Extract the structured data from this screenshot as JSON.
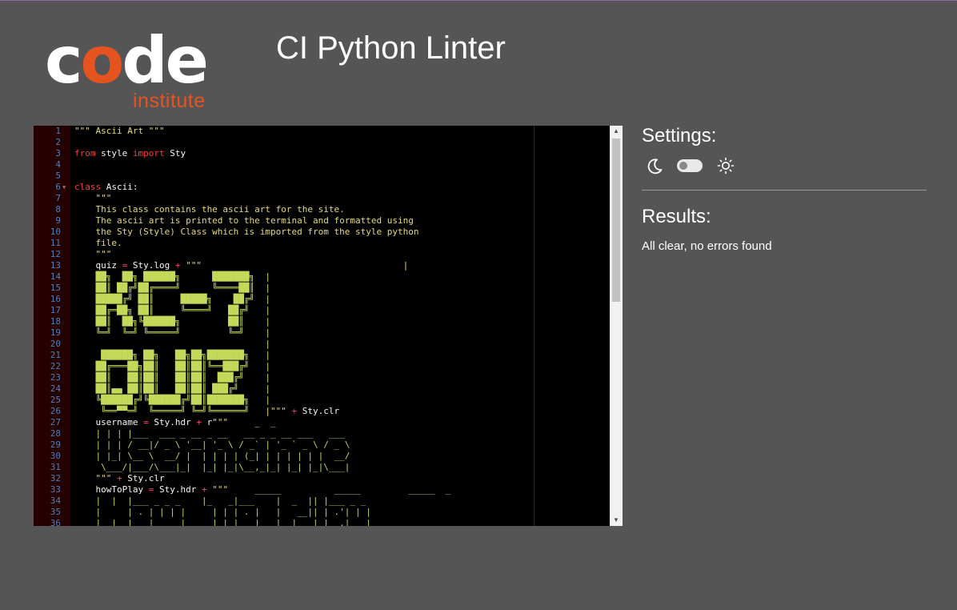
{
  "logo": {
    "word_c": "c",
    "word_o": "o",
    "word_de": "de",
    "sub": "institute"
  },
  "header": {
    "title": "CI Python Linter"
  },
  "sidebar": {
    "settings_heading": "Settings:",
    "results_heading": "Results:",
    "results_text": "All clear, no errors found",
    "toggle_state": "off"
  },
  "editor": {
    "lines": [
      [
        [
          "str",
          "\"\"\" Ascii Art \"\"\""
        ]
      ],
      [],
      [
        [
          "kw",
          "from"
        ],
        [
          "id",
          " style "
        ],
        [
          "kw",
          "import"
        ],
        [
          "id",
          " Sty"
        ]
      ],
      [],
      [],
      [
        [
          "kw",
          "class"
        ],
        [
          "id",
          " Ascii:"
        ]
      ],
      [
        [
          "str",
          "    \"\"\""
        ]
      ],
      [
        [
          "str",
          "    This class contains the ascii art for the site."
        ]
      ],
      [
        [
          "str",
          "    The ascii art is printed to the terminal and formatted using"
        ]
      ],
      [
        [
          "str",
          "    the Sty (Style) Class which is imported from the style python"
        ]
      ],
      [
        [
          "str",
          "    file."
        ]
      ],
      [
        [
          "str",
          "    \"\"\""
        ]
      ],
      [
        [
          "id",
          "    quiz "
        ],
        [
          "op",
          "="
        ],
        [
          "id",
          " Sty.log "
        ],
        [
          "op",
          "+"
        ],
        [
          "str",
          " \"\"\"                                      |"
        ]
      ],
      [
        [
          "art",
          "    ██╗  ██╗ ██████╗      ███████╗  |"
        ]
      ],
      [
        [
          "art",
          "    ██║ ██╔╝██╔════╝      ╚════██║  |"
        ]
      ],
      [
        [
          "art",
          "    █████╔╝ ██║     █████╗    ██╔╝  |"
        ]
      ],
      [
        [
          "art",
          "    ██╔═██╗ ██║     ╚════╝   ██╔╝   |"
        ]
      ],
      [
        [
          "art",
          "    ██║  ██╗╚██████╗         ██║    |"
        ]
      ],
      [
        [
          "art",
          "    ╚═╝  ╚═╝ ╚═════╝         ╚═╝    |"
        ]
      ],
      [
        [
          "art",
          "                                    |"
        ]
      ],
      [
        [
          "art",
          "     ██████╗ ██╗   ██╗██╗███████╗   |"
        ]
      ],
      [
        [
          "art",
          "    ██╔═══██╗██║   ██║██║╚══███╔╝   |"
        ]
      ],
      [
        [
          "art",
          "    ██║   ██║██║   ██║██║  ███╔╝    |"
        ]
      ],
      [
        [
          "art",
          "    ██║▄▄ ██║██║   ██║██║ ███╔╝     |"
        ]
      ],
      [
        [
          "art",
          "    ╚██████╔╝╚██████╔╝██║███████╗   |"
        ]
      ],
      [
        [
          "art",
          "     ╚══▀▀═╝  ╚═════╝ ╚═╝╚══════╝   "
        ],
        [
          "str",
          "|\"\"\""
        ],
        [
          "op",
          " +"
        ],
        [
          "id",
          " Sty.clr"
        ]
      ],
      [
        [
          "id",
          "    username "
        ],
        [
          "op",
          "="
        ],
        [
          "id",
          " Sty.hdr "
        ],
        [
          "op",
          "+"
        ],
        [
          "id",
          " r"
        ],
        [
          "str",
          "\"\"\"     _  _"
        ]
      ],
      [
        [
          "art",
          "    | | | |___  ___ _ __ _ __   __ _ _ __ ___   ___"
        ]
      ],
      [
        [
          "art",
          "    | | | / __|/ _ \\ '__| '_ \\ / _` | '_ ` _ \\ / _ \\"
        ]
      ],
      [
        [
          "art",
          "    | |_| \\__ \\  __/ |  | | | | (_| | | | | | |  __/"
        ]
      ],
      [
        [
          "art",
          "     \\___/|___/\\___|_|  |_| |_|\\__,_|_| |_| |_|\\___|"
        ]
      ],
      [
        [
          "str",
          "    \"\"\""
        ],
        [
          "op",
          " +"
        ],
        [
          "id",
          " Sty.clr"
        ]
      ],
      [
        [
          "id",
          "    howToPlay "
        ],
        [
          "op",
          "="
        ],
        [
          "id",
          " Sty.hdr "
        ],
        [
          "op",
          "+"
        ],
        [
          "str",
          " \"\"\"     _____          _____         _____  _"
        ]
      ],
      [
        [
          "art",
          "    |  |  |___ _ _ _    |_   _|___    |  _  || |___ _ _"
        ]
      ],
      [
        [
          "art",
          "    |     | . | | | |     | | | . |   |   __|| | .'| | |"
        ]
      ],
      [
        [
          "art",
          "    |__|__|___|_____|     |_| |___|   |__|   |_|__,|_  |"
        ]
      ]
    ]
  }
}
